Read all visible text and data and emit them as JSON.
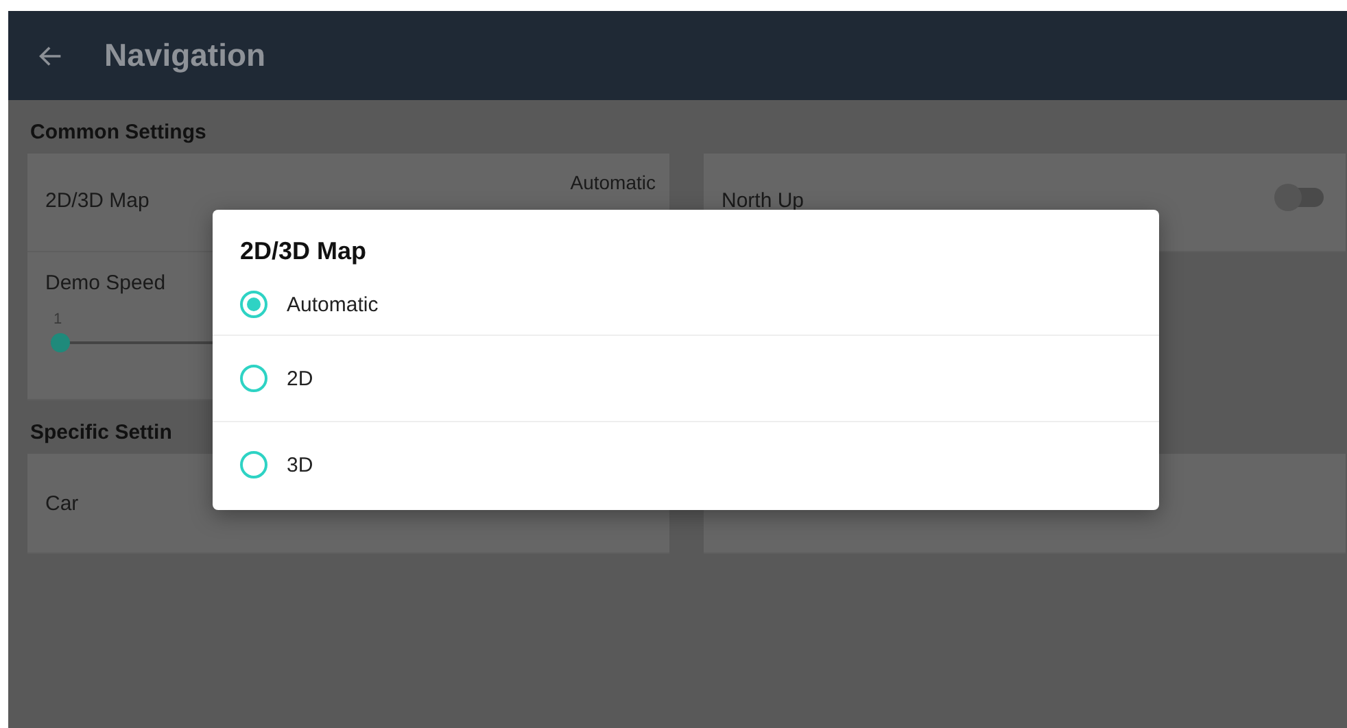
{
  "header": {
    "title": "Navigation"
  },
  "sections": [
    {
      "heading": "Common Settings",
      "items": [
        {
          "kind": "value",
          "label": "2D/3D Map",
          "value": "Automatic"
        },
        {
          "kind": "toggle",
          "label": "North Up",
          "on": false
        },
        {
          "kind": "slider",
          "label": "Demo Speed",
          "reading": "1",
          "level": 0
        }
      ]
    },
    {
      "heading": "Specific Settin",
      "items": [
        {
          "kind": "plain",
          "label": "Car"
        },
        {
          "kind": "blank"
        }
      ]
    }
  ],
  "dialog": {
    "title": "2D/3D Map",
    "options": [
      {
        "label": "Automatic",
        "selected": true
      },
      {
        "label": "2D",
        "selected": false
      },
      {
        "label": "3D",
        "selected": false
      }
    ]
  }
}
